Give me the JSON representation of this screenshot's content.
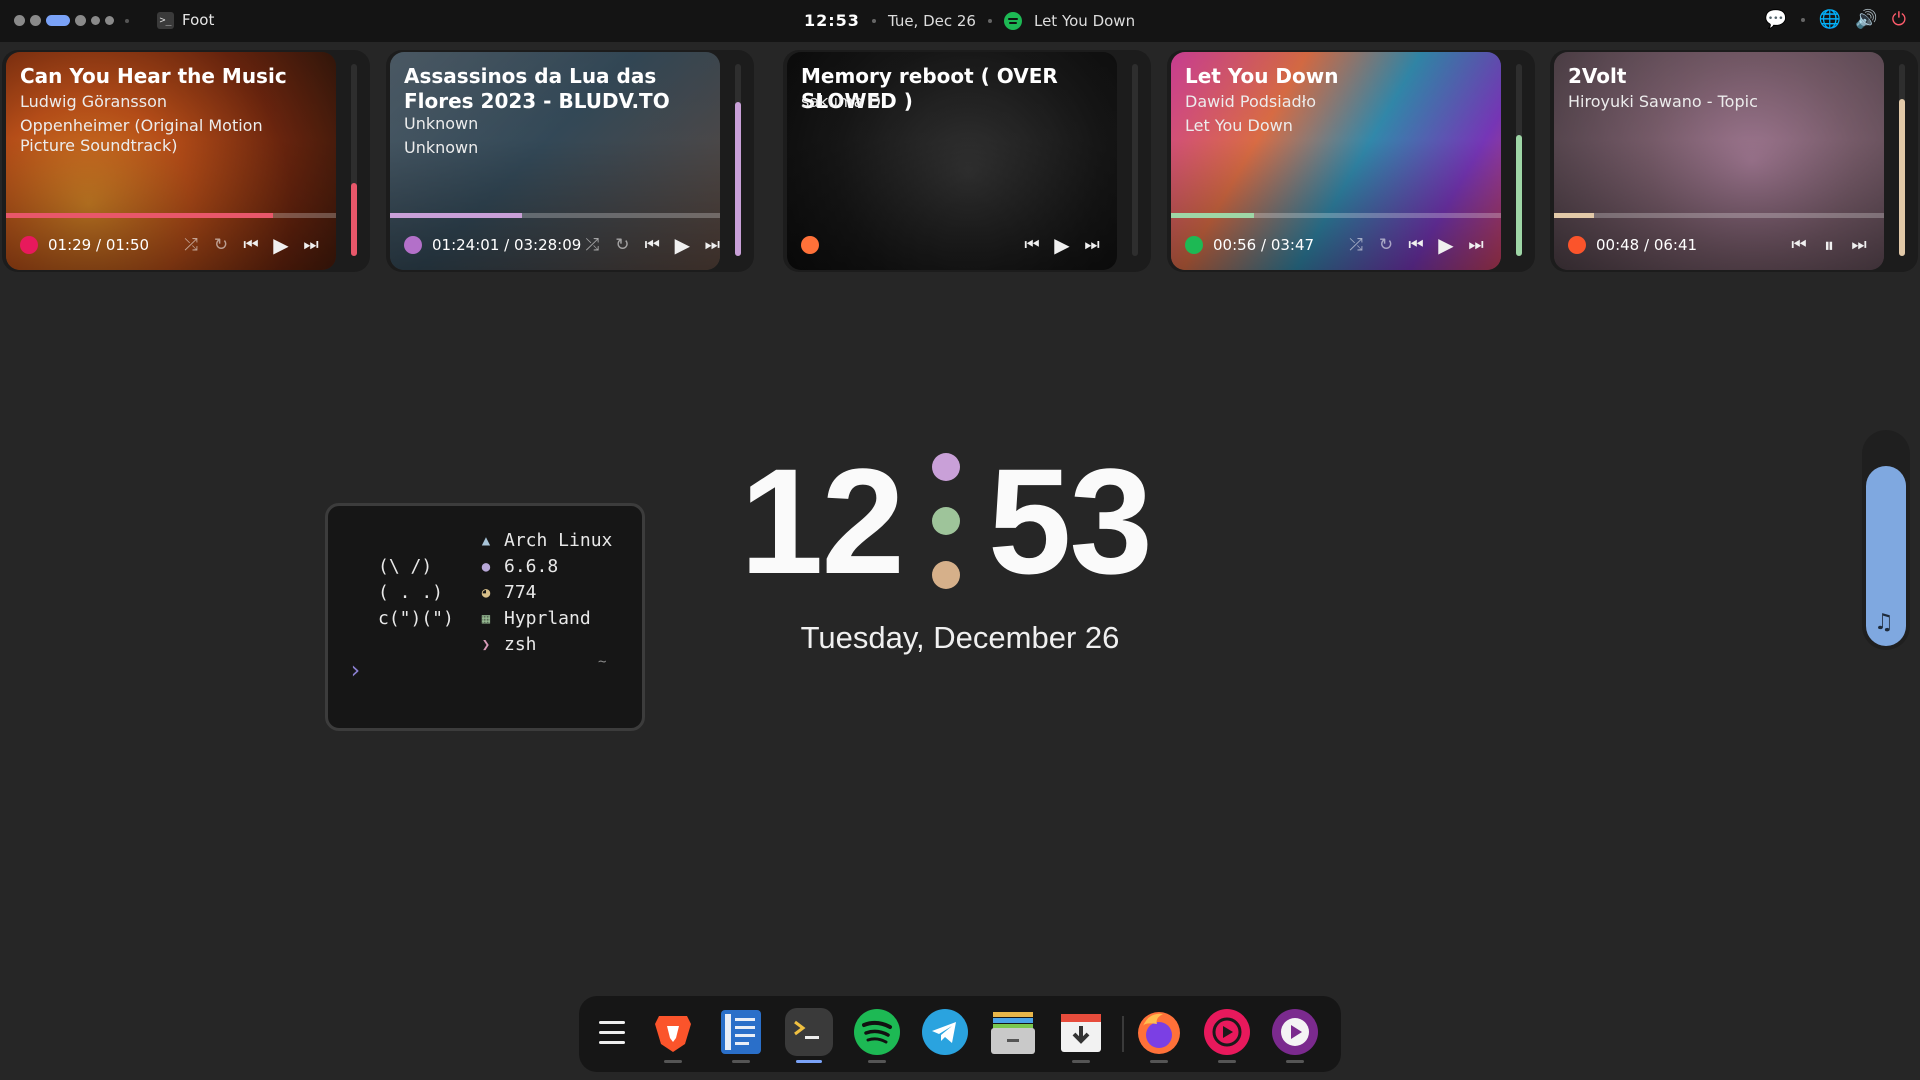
{
  "topbar": {
    "window_title": "Foot",
    "time": "12:53",
    "date": "Tue, Dec 26",
    "now_playing": "Let You Down"
  },
  "cards": [
    {
      "title": "Can You Hear the Music",
      "artist": "Ludwig Göransson",
      "album": "Oppenheimer (Original Motion Picture Soundtrack)",
      "time": "01:29 / 01:50",
      "progress": 0.81,
      "volume": 0.38,
      "accent": "#e8576a",
      "source_icon": "youtube-music-icon",
      "controls": [
        "shuffle",
        "repeat",
        "previous",
        "play",
        "next"
      ]
    },
    {
      "title": "Assassinos da Lua das Flores 2023 - BLUDV.TO",
      "artist": "Unknown",
      "album": "Unknown",
      "time": "01:24:01 / 03:28:09",
      "progress": 0.4,
      "volume": 0.8,
      "accent": "#c9a0d8",
      "source_icon": "media-player-icon",
      "controls": [
        "shuffle",
        "repeat",
        "previous",
        "play",
        "next"
      ]
    },
    {
      "title": "Memory reboot ( OVER SLOWED )",
      "artist": "sakuma D",
      "album": "",
      "time": "",
      "progress": 0,
      "volume": 0,
      "accent": "#ffffff",
      "source_icon": "firefox-icon",
      "controls": [
        "previous",
        "play",
        "next"
      ]
    },
    {
      "title": "Let You Down",
      "artist": "Dawid Podsiadło",
      "album": "Let You Down",
      "time": "00:56 / 03:47",
      "progress": 0.25,
      "volume": 0.63,
      "accent": "#9ed6a6",
      "source_icon": "spotify-icon",
      "controls": [
        "shuffle",
        "repeat",
        "previous",
        "play",
        "next"
      ]
    },
    {
      "title": "2Volt",
      "artist": "Hiroyuki Sawano - Topic",
      "album": "",
      "time": "00:48 / 06:41",
      "progress": 0.12,
      "volume": 0.82,
      "accent": "#e2c9a8",
      "source_icon": "brave-icon",
      "controls": [
        "previous",
        "pause",
        "next"
      ]
    }
  ],
  "clock": {
    "hours": "12",
    "minutes": "53",
    "dot_colors": [
      "#c9a0d8",
      "#9ec49a",
      "#d6b08a"
    ],
    "date": "Tuesday, December 26"
  },
  "terminal": {
    "ascii": "(\\ /)\n( . .)\nc(\")(\")",
    "fetch": [
      {
        "icon": "arch-linux-icon",
        "text": "Arch Linux"
      },
      {
        "icon": "linux-kernel-icon",
        "text": "6.6.8"
      },
      {
        "icon": "packages-icon",
        "text": "774"
      },
      {
        "icon": "window-manager-icon",
        "text": "Hyprland"
      },
      {
        "icon": "shell-icon",
        "text": "zsh"
      }
    ],
    "cwd": "~"
  },
  "dock": {
    "apps": [
      "app-menu",
      "brave",
      "text-editor",
      "foot-terminal",
      "spotify",
      "telegram",
      "files",
      "downloader",
      "firefox",
      "youtube-music",
      "media-player"
    ],
    "active_app": "foot-terminal"
  }
}
